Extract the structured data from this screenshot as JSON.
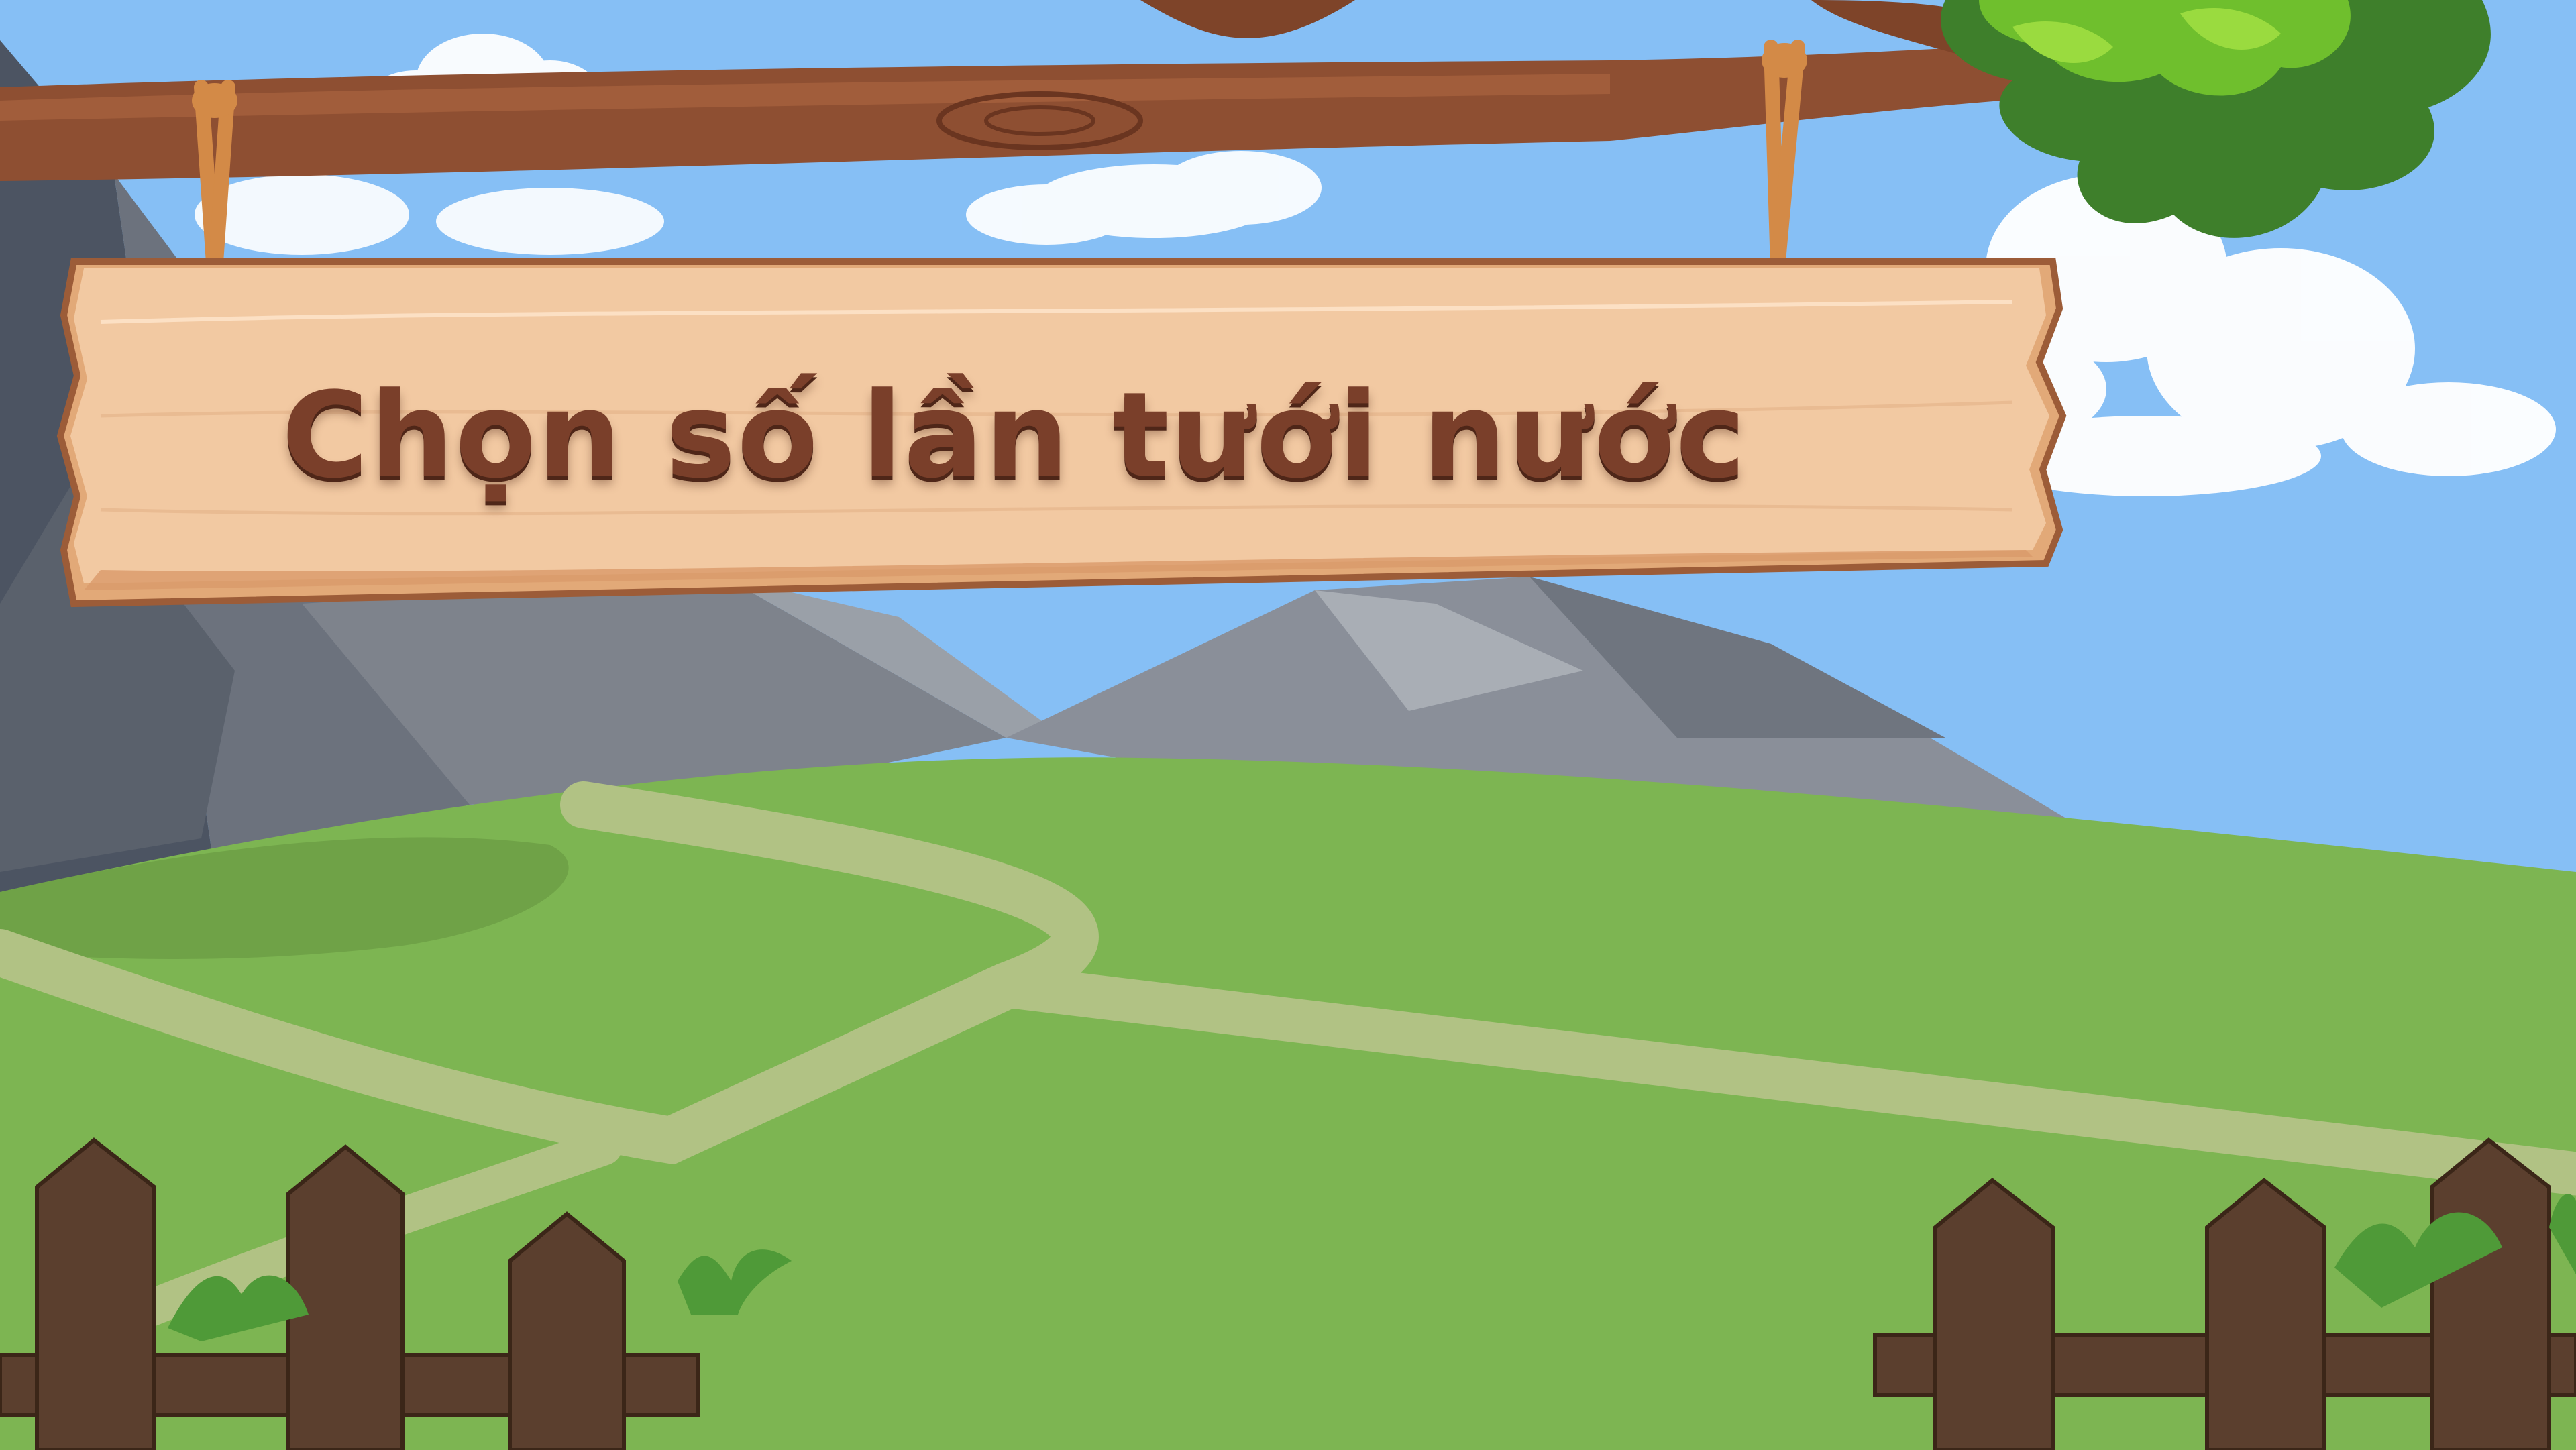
{
  "sign": {
    "title": "Chọn số lần tưới nước"
  },
  "colors": {
    "sky": "#86BFF5",
    "grass": "#7DB552",
    "path": "#B1C284",
    "mountain": "#8A8F99",
    "wood_sign": "#F2C9A2",
    "branch": "#8E4F32",
    "rope": "#D38A47",
    "leaves": "#6FBF2D",
    "fence": "#5B3F2E",
    "title_text": "#7A3F2A"
  },
  "icons": [
    "cloud-icon",
    "mountain-icon",
    "rope-icon",
    "leaves-icon",
    "fence-icon",
    "grass-tuft-icon"
  ]
}
